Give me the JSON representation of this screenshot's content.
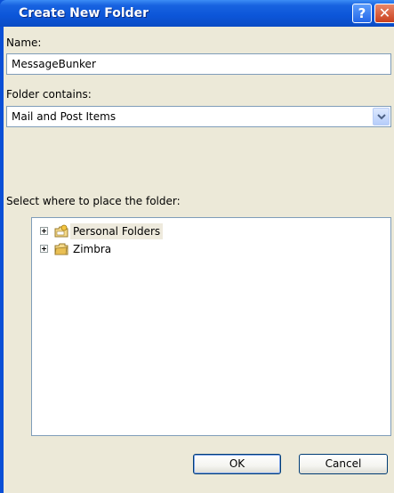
{
  "dialog": {
    "title": "Create New Folder",
    "help_glyph": "?",
    "close_glyph": "✕"
  },
  "name_field": {
    "label": "Name:",
    "value": "MessageBunker"
  },
  "contains_field": {
    "label": "Folder contains:",
    "selected": "Mail and Post Items"
  },
  "location": {
    "label": "Select where to place the folder:",
    "tree": [
      {
        "label": "Personal Folders",
        "icon": "personal-folders-icon",
        "selected": true
      },
      {
        "label": "Zimbra",
        "icon": "mailbox-folder-icon",
        "selected": false
      }
    ]
  },
  "buttons": {
    "ok": "OK",
    "cancel": "Cancel"
  },
  "colors": {
    "titlebar": "#0c55d8",
    "dialog_bg": "#ece9d8",
    "input_border": "#7f9db9"
  }
}
